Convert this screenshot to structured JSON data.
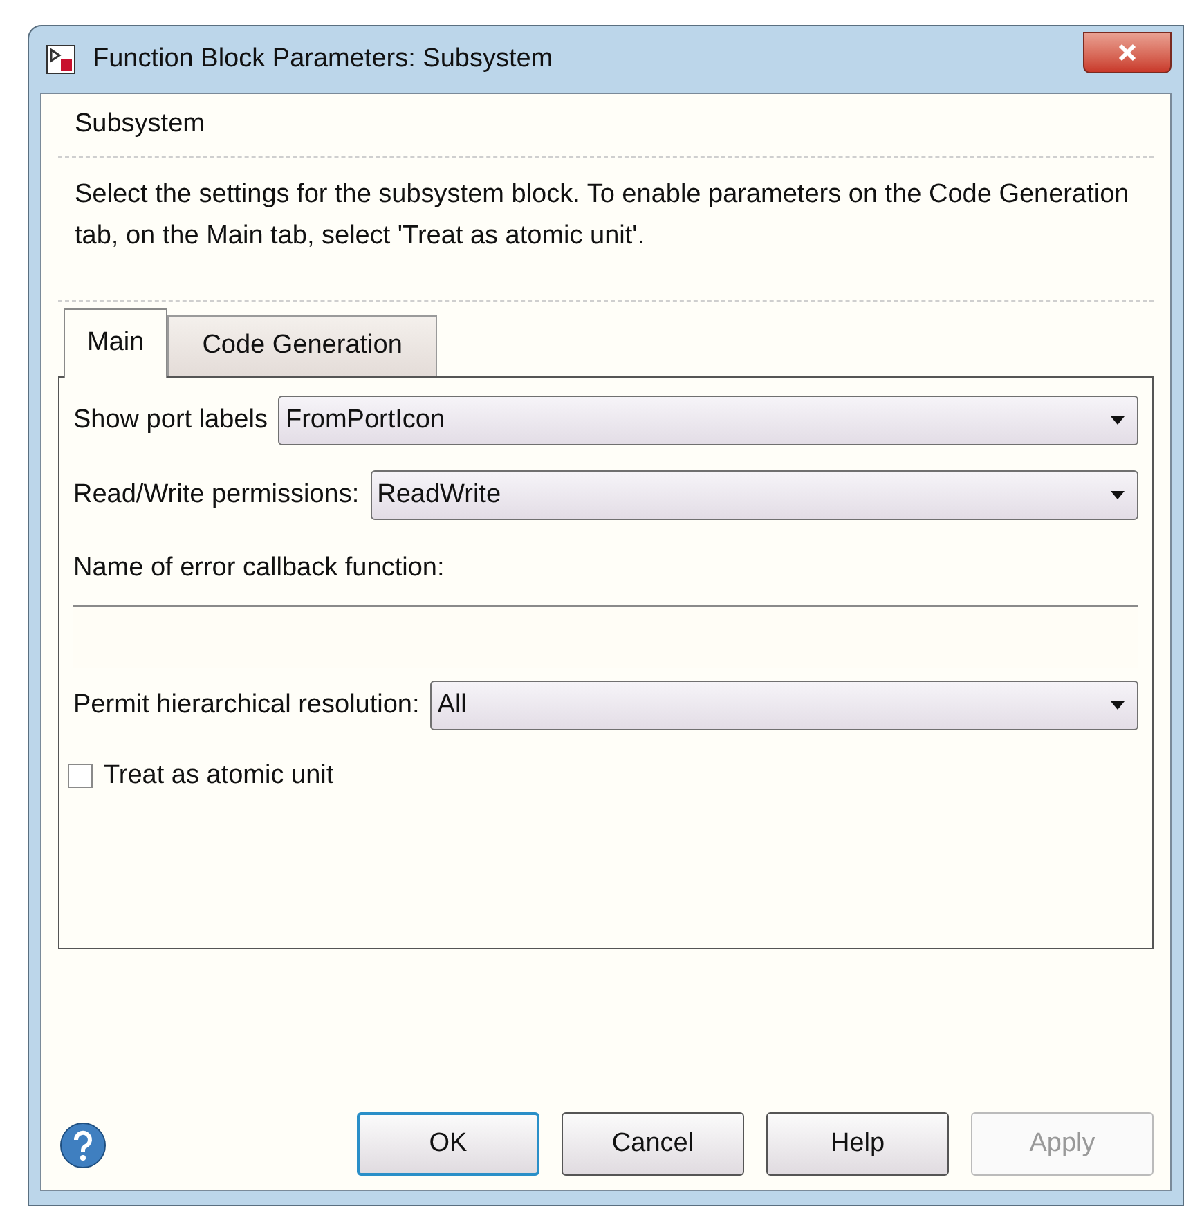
{
  "window": {
    "title": "Function Block Parameters: Subsystem"
  },
  "group": {
    "title": "Subsystem",
    "description": "Select the settings for the subsystem block. To enable parameters on the Code Generation tab, on the Main tab, select 'Treat as atomic unit'."
  },
  "tabs": [
    {
      "label": "Main",
      "selected": true
    },
    {
      "label": "Code Generation",
      "selected": false
    }
  ],
  "params": [
    {
      "kind": "dropdown",
      "label": "Show port labels",
      "value": "FromPortIcon"
    },
    {
      "kind": "dropdown",
      "label": "Read/Write permissions:",
      "value": "ReadWrite"
    },
    {
      "kind": "text",
      "label": "Name of error callback function:"
    },
    {
      "kind": "dropdown",
      "label": "Permit hierarchical resolution:",
      "value": "All"
    },
    {
      "kind": "checkbox",
      "label": "Treat as atomic unit",
      "checked": false
    }
  ],
  "buttons": [
    {
      "label": "OK",
      "default": true,
      "disabled": false
    },
    {
      "label": "Cancel",
      "default": false,
      "disabled": false
    },
    {
      "label": "Help",
      "default": false,
      "disabled": false
    },
    {
      "label": "Apply",
      "default": false,
      "disabled": true
    }
  ]
}
